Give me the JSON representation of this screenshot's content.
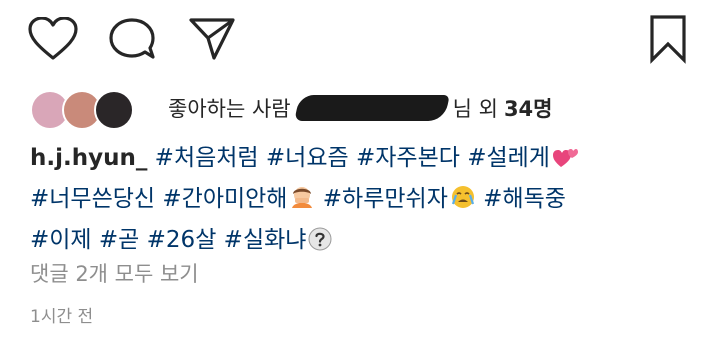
{
  "actions": {
    "like_icon": "heart-outline-icon",
    "comment_icon": "speech-bubble-icon",
    "share_icon": "paper-plane-icon",
    "save_icon": "bookmark-icon"
  },
  "likes": {
    "prefix": "좋아하는 사람",
    "suffix": "님 외",
    "count": "34명"
  },
  "caption": {
    "username": "h.j.hyun_",
    "line1": [
      "#처음처럼",
      "#너요즘",
      "#자주본다",
      "#설레게"
    ],
    "line2": [
      "#너무쓴당신",
      "#간아미안해",
      "#하루만쉬자",
      "#해독중"
    ],
    "line3": [
      "#이제",
      "#곧",
      "#26살",
      "#실화냐"
    ]
  },
  "comments_link": "댓글 2개 모두 보기",
  "timestamp": "1시간 전",
  "colors": {
    "hashtag": "#003569",
    "muted": "#8e8e8e",
    "text": "#262626"
  }
}
